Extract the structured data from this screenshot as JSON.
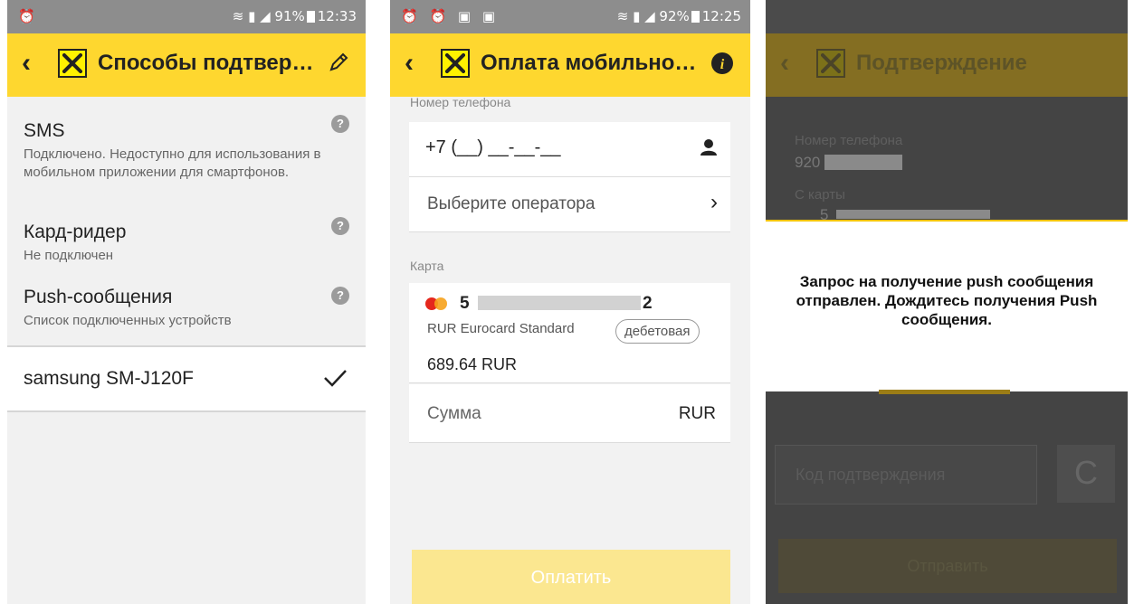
{
  "screens": [
    {
      "status": {
        "left_icons": "⏰",
        "battery": "91%",
        "time": "12:33"
      },
      "appbar": {
        "title": "Способы подтвер…",
        "action_icon": "pencil-icon"
      },
      "items": [
        {
          "title": "SMS",
          "subtitle": "Подключено. Недоступно для использования в мобильном приложении для смартфонов."
        },
        {
          "title": "Кард-ридер",
          "subtitle": "Не подключен"
        },
        {
          "title": "Push-сообщения",
          "subtitle": "Список подключенных устройств"
        }
      ],
      "device": {
        "label": "samsung SM-J120F",
        "checked": true
      }
    },
    {
      "status": {
        "left_icons": "⏰ ⏰ ▣ ▣",
        "battery": "92%",
        "time": "12:25"
      },
      "appbar": {
        "title": "Оплата мобильно…",
        "action_icon": "info-icon"
      },
      "phone": {
        "label": "Номер телефона",
        "value": "+7 (__) __-__-__"
      },
      "operator": {
        "label": "Выберите оператора"
      },
      "card": {
        "label": "Карта",
        "number_start": "5",
        "number_end": "2",
        "type": "RUR Eurocard Standard",
        "badge": "дебетовая",
        "balance": "689.64 RUR"
      },
      "amount": {
        "label": "Сумма",
        "currency": "RUR"
      },
      "pay_button": "Оплатить"
    },
    {
      "appbar": {
        "title": "Подтверждение"
      },
      "phone_label": "Номер телефона",
      "phone_value": "920",
      "card_label": "С карты",
      "card_value": "5",
      "dialog_message": "Запрос на получение push сообщения отправлен. Дождитесь получения Push сообщения.",
      "code_placeholder": "Код подтверждения",
      "confirm_button": "Отправить"
    }
  ],
  "colors": {
    "accent": "#fed72f",
    "logo_yellow": "#fff200",
    "statusbar": "#8d8d8d"
  }
}
